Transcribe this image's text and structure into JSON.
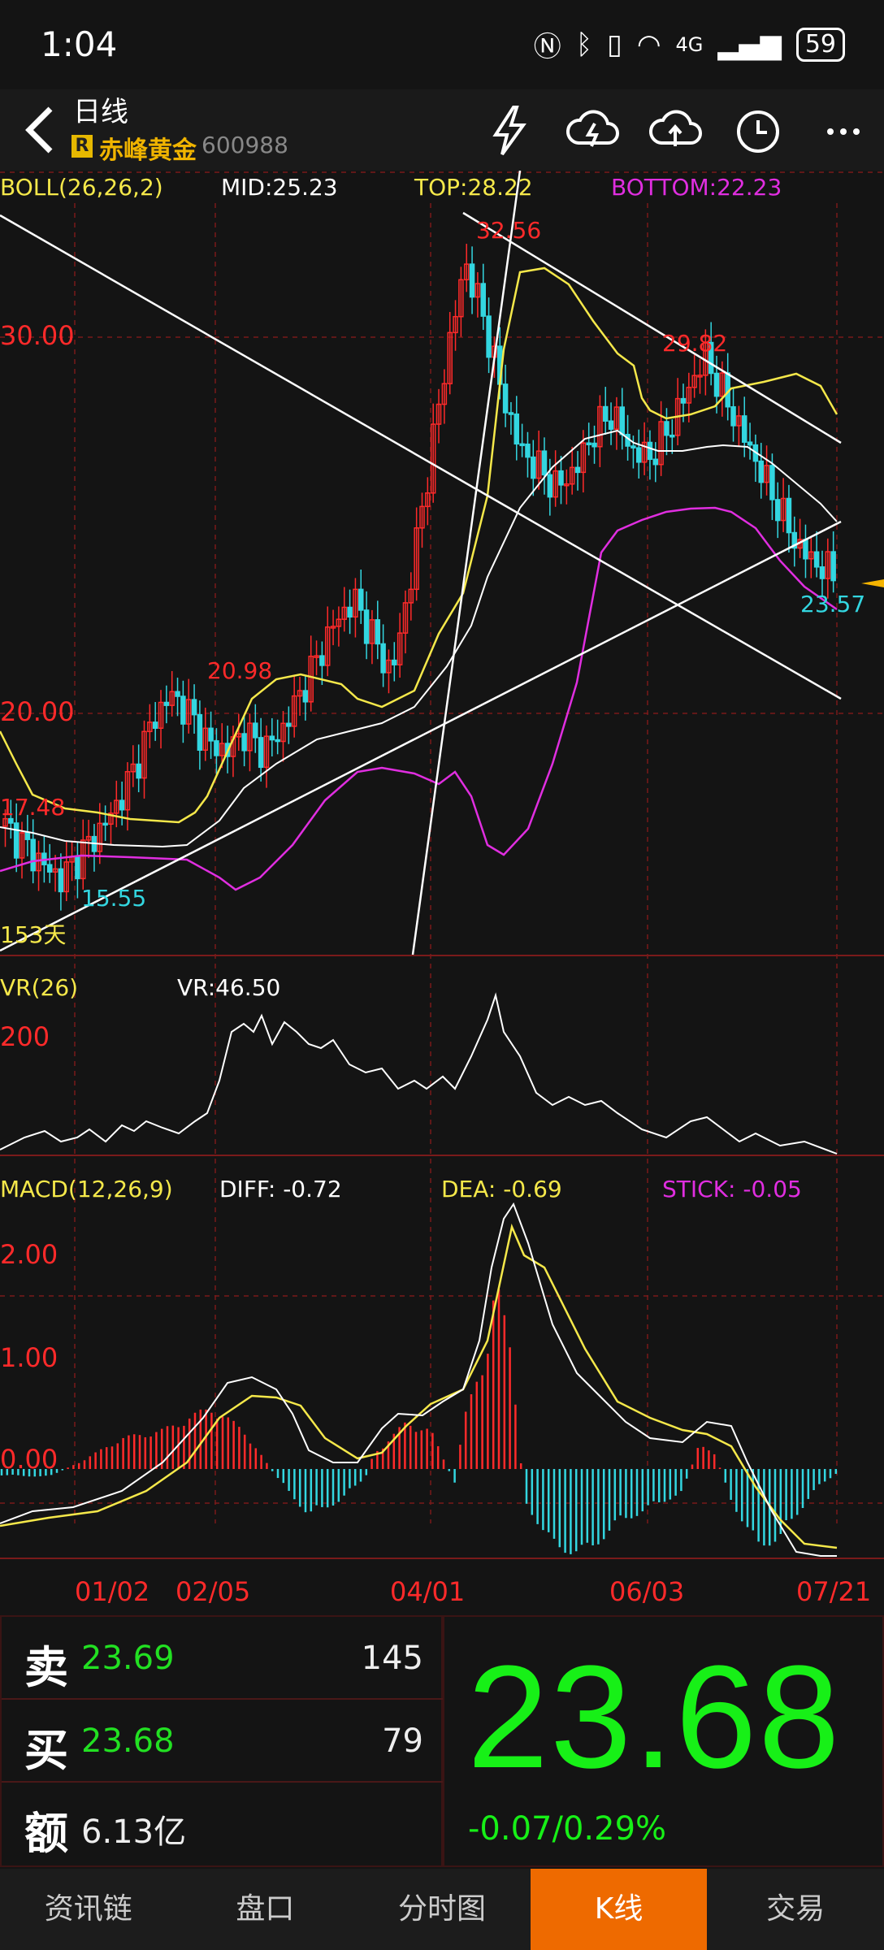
{
  "status": {
    "time": "1:04",
    "network": "4G",
    "battery": "59"
  },
  "header": {
    "title": "日线",
    "badge": "R",
    "stock_name": "赤峰黄金",
    "stock_code": "600988"
  },
  "boll": {
    "label": "BOLL(26,26,2)",
    "mid": "MID:25.23",
    "top": "TOP:28.22",
    "bottom": "BOTTOM:22.23"
  },
  "main_chart": {
    "y_labels": [
      "30.00",
      "20.00"
    ],
    "annotations": {
      "high": "32.56",
      "peak2": "29.82",
      "left_high": "20.98",
      "left_mid": "17.48",
      "low": "15.55",
      "last": "23.57",
      "days": "153天"
    }
  },
  "vr": {
    "label": "VR(26)",
    "value": "VR:46.50",
    "y_label": "200"
  },
  "macd": {
    "label": "MACD(12,26,9)",
    "diff": "DIFF: -0.72",
    "dea": "DEA: -0.69",
    "stick": "STICK: -0.05",
    "y_labels": [
      "2.00",
      "1.00",
      "0.00"
    ]
  },
  "dates": [
    "01/02",
    "02/05",
    "04/01",
    "06/03",
    "07/21"
  ],
  "colors": {
    "up": "#ff2a2a",
    "down": "#33d6e0",
    "mid": "#ffffff",
    "top": "#f5e84a",
    "bottom": "#e02ee0",
    "price": "#17f017",
    "accent": "#ee6a00"
  },
  "quote": {
    "sell": {
      "key": "卖",
      "price": "23.69",
      "vol": "145"
    },
    "buy": {
      "key": "买",
      "price": "23.68",
      "vol": "79"
    },
    "amount": {
      "key": "额",
      "value": "6.13亿"
    },
    "last": "23.68",
    "change": "-0.07/0.29%"
  },
  "tabs": [
    "资讯链",
    "盘口",
    "分时图",
    "K线",
    "交易"
  ],
  "chart_data": {
    "type": "candlestick",
    "x_ticks": [
      "01/02",
      "02/05",
      "04/01",
      "06/03",
      "07/21"
    ],
    "close_path": [
      17.0,
      16.5,
      16.0,
      15.6,
      16.2,
      16.8,
      17.5,
      18.5,
      19.8,
      20.5,
      20.0,
      19.2,
      19.0,
      19.5,
      19.0,
      19.5,
      20.5,
      21.5,
      22.5,
      23.0,
      22.0,
      21.0,
      23.5,
      26.5,
      29.5,
      32.0,
      30.5,
      28.5,
      27.0,
      26.5,
      26.0,
      26.5,
      27.5,
      28.0,
      27.0,
      26.8,
      27.5,
      28.5,
      29.5,
      28.5,
      27.5,
      26.5,
      25.5,
      24.5,
      24.0,
      23.7
    ],
    "boll_top": [
      19.0,
      17.5,
      17.2,
      17.0,
      17.2,
      18.5,
      20.0,
      20.8,
      20.8,
      20.5,
      20.3,
      20.0,
      20.3,
      21.0,
      22.5,
      24.0,
      29.5,
      32.0,
      31.5,
      30.5,
      29.5,
      28.5,
      27.5,
      27.0,
      27.5,
      28.5,
      29.0,
      29.2,
      28.5
    ],
    "boll_mid": [
      17.0,
      16.6,
      16.2,
      16.2,
      16.5,
      17.5,
      18.8,
      19.3,
      19.6,
      19.8,
      20.0,
      20.5,
      21.5,
      23.0,
      25.0,
      26.2,
      26.8,
      27.0,
      26.8,
      26.5,
      26.5,
      27.2,
      27.5,
      27.0,
      26.0,
      25.2
    ],
    "boll_bottom": [
      16.0,
      15.3,
      15.0,
      14.5,
      14.4,
      15.0,
      16.5,
      17.3,
      17.5,
      17.3,
      17.2,
      17.2,
      16.5,
      16.3,
      17.0,
      20.5,
      24.5,
      24.8,
      25.0,
      25.4,
      25.3,
      24.0,
      23.0,
      22.2
    ]
  }
}
